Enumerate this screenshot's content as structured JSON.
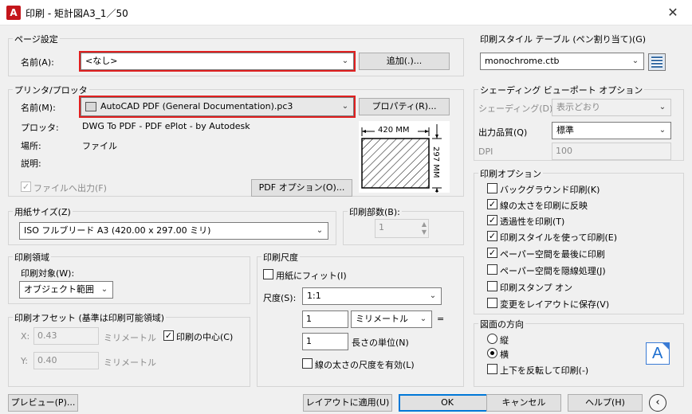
{
  "window": {
    "title": "印刷 - 矩計図A3_1／50",
    "app_icon": "A"
  },
  "page_setup": {
    "label": "ページ設定",
    "name_label": "名前(A):",
    "name_value": "<なし>",
    "add_button": "追加(.)..."
  },
  "printer": {
    "label": "プリンタ/プロッタ",
    "name_label": "名前(M):",
    "name_value": "AutoCAD PDF (General Documentation).pc3",
    "properties_button": "プロパティ(R)...",
    "plotter_label": "プロッタ:",
    "plotter_value": "DWG To PDF - PDF ePlot - by Autodesk",
    "location_label": "場所:",
    "location_value": "ファイル",
    "description_label": "説明:",
    "print_to_file": "ファイルへ出力(F)",
    "pdf_options_button": "PDF オプション(O)...",
    "preview_width": "420",
    "preview_height": "297",
    "preview_unit": "MM"
  },
  "paper_size": {
    "label": "用紙サイズ(Z)",
    "value": "ISO フルブリード A3 (420.00 x 297.00 ミリ)"
  },
  "copies": {
    "label": "印刷部数(B):",
    "value": "1"
  },
  "plot_area": {
    "label": "印刷領域",
    "what_label": "印刷対象(W):",
    "what_value": "オブジェクト範囲"
  },
  "plot_offset": {
    "label": "印刷オフセット (基準は印刷可能領域)",
    "x_label": "X:",
    "x_value": "0.43",
    "x_unit": "ミリメートル",
    "y_label": "Y:",
    "y_value": "0.40",
    "y_unit": "ミリメートル",
    "center_label": "印刷の中心(C)"
  },
  "plot_scale": {
    "label": "印刷尺度",
    "fit_label": "用紙にフィット(I)",
    "scale_label": "尺度(S):",
    "scale_value": "1:1",
    "value1": "1",
    "unit_value": "ミリメートル",
    "equals": "=",
    "value2": "1",
    "length_unit_label": "長さの単位(N)",
    "scale_lineweights": "線の太さの尺度を有効(L)"
  },
  "style_table": {
    "label": "印刷スタイル テーブル (ペン割り当て)(G)",
    "value": "monochrome.ctb"
  },
  "shaded": {
    "label": "シェーディング ビューポート オプション",
    "shade_label": "シェーディング(D)",
    "shade_value": "表示どおり",
    "quality_label": "出力品質(Q)",
    "quality_value": "標準",
    "dpi_label": "DPI",
    "dpi_value": "100"
  },
  "plot_options": {
    "label": "印刷オプション",
    "items": [
      {
        "label": "バックグラウンド印刷(K)",
        "checked": false
      },
      {
        "label": "線の太さを印刷に反映",
        "checked": true
      },
      {
        "label": "透過性を印刷(T)",
        "checked": true
      },
      {
        "label": "印刷スタイルを使って印刷(E)",
        "checked": true
      },
      {
        "label": "ペーパー空間を最後に印刷",
        "checked": true
      },
      {
        "label": "ペーパー空間を隠線処理(J)",
        "checked": false
      },
      {
        "label": "印刷スタンプ オン",
        "checked": false
      },
      {
        "label": "変更をレイアウトに保存(V)",
        "checked": false
      }
    ]
  },
  "orientation": {
    "label": "図面の方向",
    "portrait": "縦",
    "landscape": "横",
    "upside_down": "上下を反転して印刷(-)",
    "icon_letter": "A"
  },
  "footer": {
    "preview": "プレビュー(P)...",
    "apply_layout": "レイアウトに適用(U)",
    "ok": "OK",
    "cancel": "キャンセル",
    "help": "ヘルプ(H)",
    "collapse_icon": "chevron-left-circle"
  }
}
